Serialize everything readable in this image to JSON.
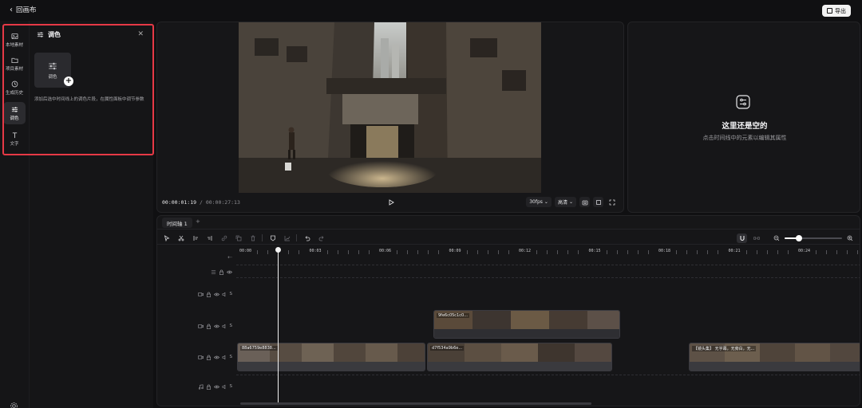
{
  "topbar": {
    "back_label": "回画布",
    "export_label": "导出"
  },
  "rail": {
    "items": [
      {
        "label": "本地素材",
        "icon": "image-icon"
      },
      {
        "label": "项目素材",
        "icon": "folder-icon"
      },
      {
        "label": "生成历史",
        "icon": "clock-icon"
      },
      {
        "label": "调色",
        "icon": "sliders-icon",
        "active": true
      },
      {
        "label": "文字",
        "icon": "text-icon"
      }
    ],
    "settings_icon": "gear-icon"
  },
  "panel": {
    "title": "调色",
    "tile_label": "调色",
    "description": "添加后选中时间线上的调色片段，在属性面板中调节参数"
  },
  "preview": {
    "current_time": "00:00:01:19",
    "separator": "/",
    "total_time": "00:00:27:13",
    "fps": "30fps",
    "quality": "高清"
  },
  "properties": {
    "empty_title": "这里还是空的",
    "empty_subtitle": "点击时间线中的元素以编辑其属性"
  },
  "timeline": {
    "tab_label": "时间轴 1",
    "add_tab": "+",
    "ruler_labels": [
      "00:00",
      "00:03",
      "00:06",
      "00:09",
      "00:12",
      "00:15",
      "00:18",
      "00:21",
      "00:24"
    ],
    "playhead_time_seconds": 1.63,
    "zoom_level": 0.25,
    "track_marker": "S",
    "clips": {
      "upper_video": "9fe6c05c1c0...",
      "main_a": "88a6759e8838...",
      "main_b": "d7f534a9b6e...",
      "main_c": "【镜头集】 无字幕，无旁白，无..."
    }
  },
  "colors": {
    "accent_highlight": "#e63946",
    "background": "#101012",
    "panel": "#161618"
  }
}
